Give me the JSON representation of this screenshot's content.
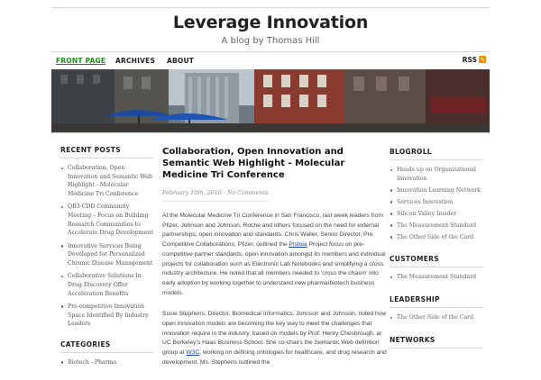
{
  "site": {
    "title": "Leverage Innovation",
    "description": "A blog by Thomas Hill"
  },
  "nav": {
    "items": [
      "FRONT PAGE",
      "ARCHIVES",
      "ABOUT"
    ],
    "rss_label": "RSS"
  },
  "sidebar_left": {
    "recent_posts_title": "RECENT POSTS",
    "recent_posts": [
      "Collaboration, Open Innovation and Semantic Web Highlight - Molecular Medicine Tri Conference",
      "QB3-CDD Community Meeting – Focus on Building Research Communities to Accelerate Drug Development",
      "Innovative Services Being Developed for Personalized Chronic Disease Management",
      "Collaborative Solutions In Drug Discovery Offer Acceleration Benefits",
      "Pre-competitive Innovation Space Identified By Industry Leaders"
    ],
    "categories_title": "CATEGORIES",
    "categories": [
      "Biotech - Pharma"
    ]
  },
  "post": {
    "title": "Collaboration, Open Innovation and Semantic Web Highlight - Molecular Medicine Tri Conference",
    "date": "February 10th, 2010",
    "meta_sep": " · ",
    "comments": "No Comments",
    "p1_a": "At the Molecular Medicine Tri Conference in San Francisco, last week leaders from Pfizer, Johnson and Johnson, Roche and others focused on the need for external partnerships, open innovation and standards.  Chris Waller, Senior Director, Pre Competitive Collaborations, Pfizer, outlined the ",
    "p1_link": "Pistoia",
    "p1_b": " Project focus on pre-competitive partner standards, open innovation amongst its members and individual projects for collaboration such as Electronic Lab Notebooks and simplifying a cross industry architecture. He noted that all members needed to ‘cross the chasm’ into early adoption by working together to understand new pharma/biotech business models.",
    "p2_a": "Susie Stephens, Director, Biomedical Informatics, Johnson and Johnson, noted how open innovation models are becoming the key way to meet the challenges that innovation require in the industry, based on models by Prof. Henry Chesbrough, at UC Berkeley’s Haas Business School.  She co-chairs the Semantic Web definition group at ",
    "p2_link": "W3C",
    "p2_b": ", working on defining ontologies for healthcare, and drug research and development.  Ms. Stephens outlined the"
  },
  "sidebar_right": {
    "blogroll_title": "BLOGROLL",
    "blogroll": [
      "Heads up on Organizational Innovation",
      "Innovation Learning Network",
      "Services Innovation",
      "Silicon Valley Insider",
      "The Measurement Standard",
      "The Other Side of the Card"
    ],
    "customers_title": "CUSTOMERS",
    "customers": [
      "The Measurement Standard"
    ],
    "leadership_title": "LEADERSHIP",
    "leadership": [
      "The Other Side of the Card"
    ],
    "networks_title": "NETWORKS"
  },
  "colors": {
    "nav_active": "#1e8f16",
    "link": "#1a45a5",
    "rss": "#f28c00"
  },
  "icons": [
    "rss-feed-icon"
  ]
}
